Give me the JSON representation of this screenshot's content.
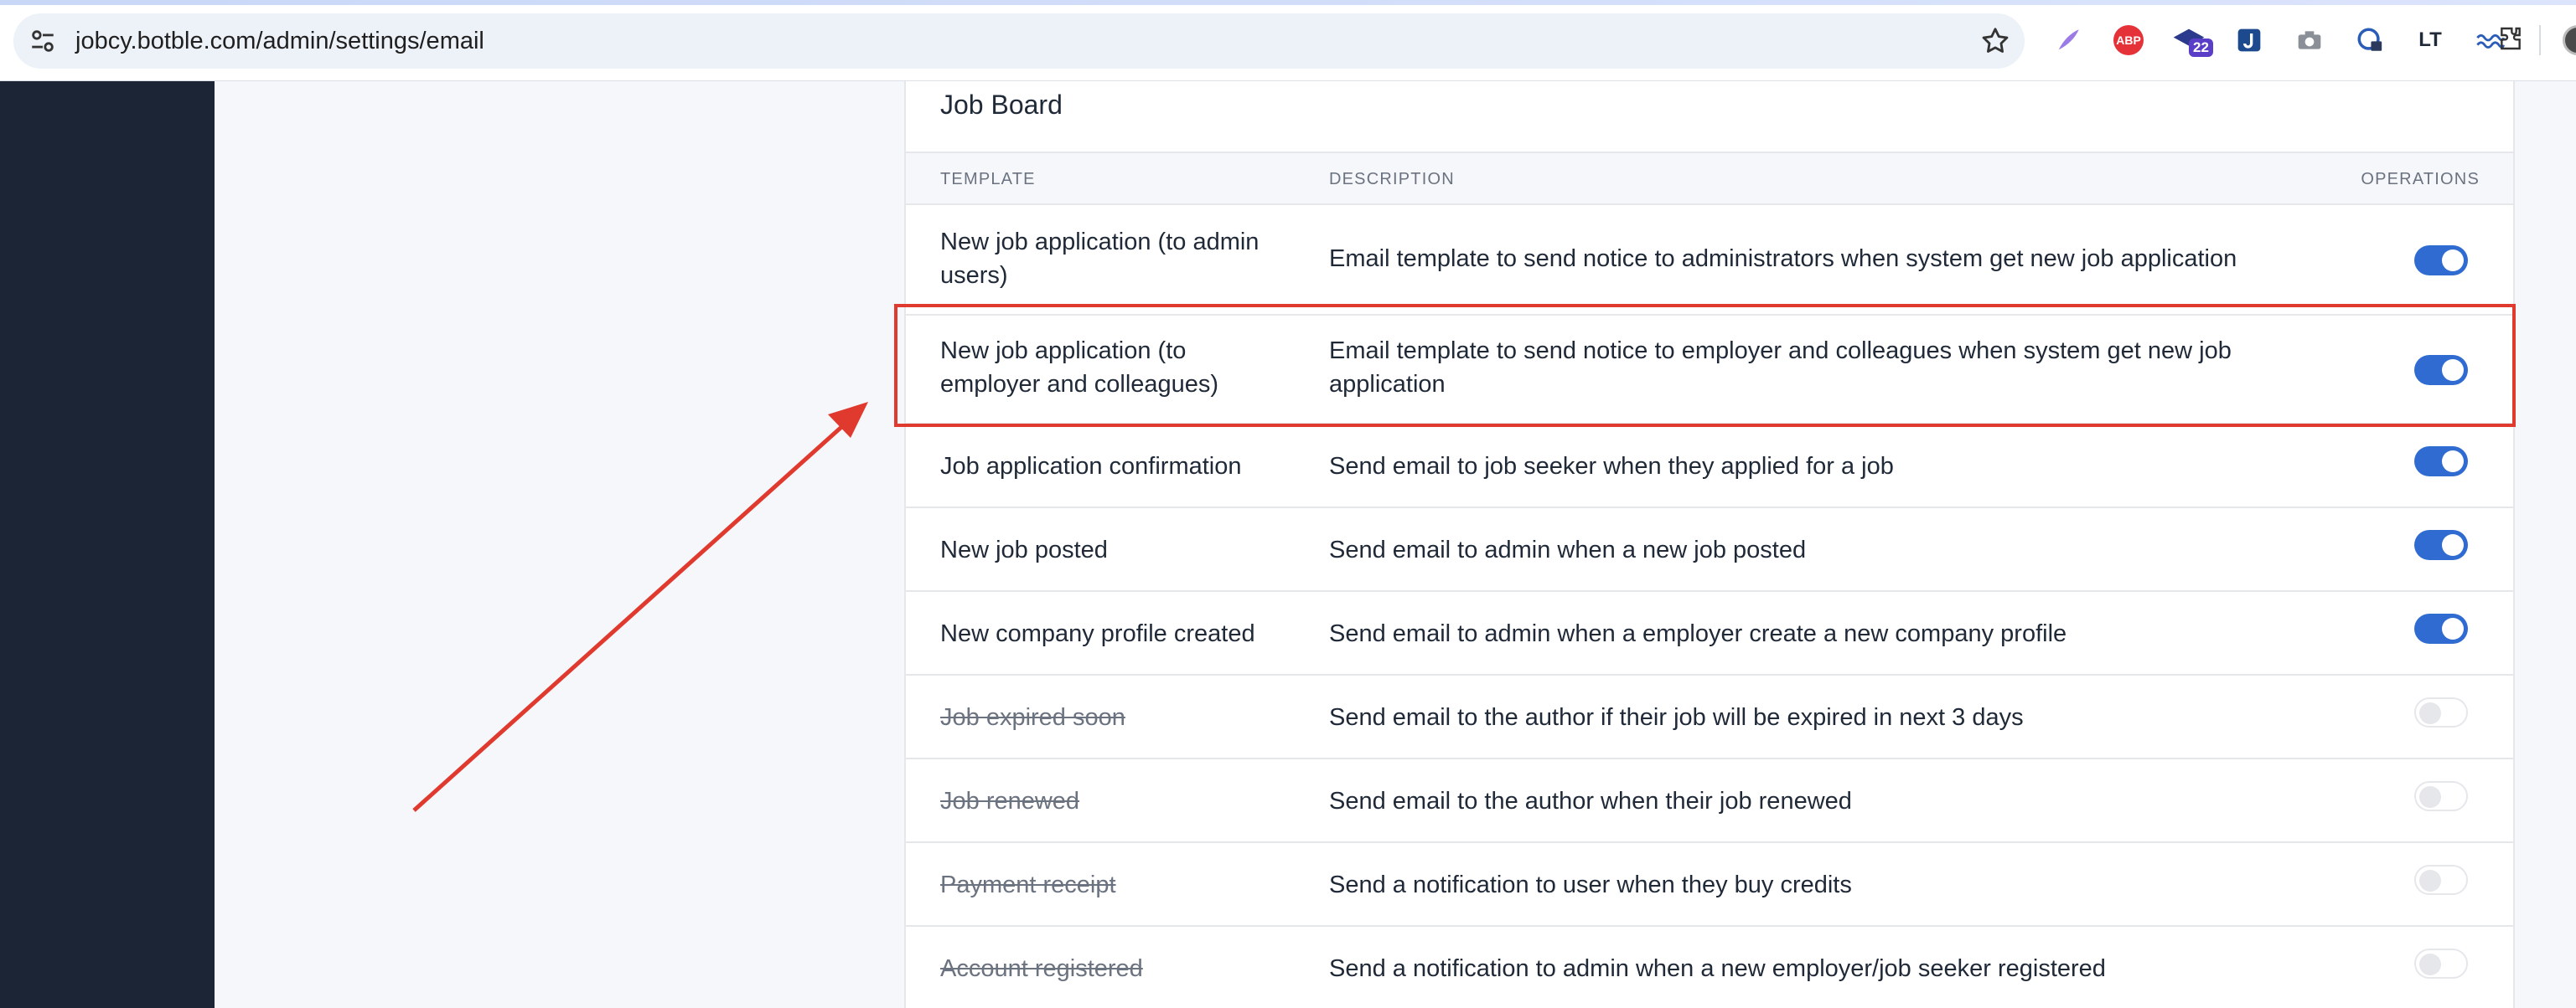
{
  "browser": {
    "url": "jobcy.botble.com/admin/settings/email",
    "extensions": [
      {
        "name": "quill-icon"
      },
      {
        "name": "adblock-icon",
        "label": "ABP"
      },
      {
        "name": "grad-cap-icon",
        "badge": "22"
      },
      {
        "name": "jira-icon"
      },
      {
        "name": "camera-icon"
      },
      {
        "name": "key-lock-icon"
      },
      {
        "name": "languagetool-icon",
        "label": "LT"
      },
      {
        "name": "wave-icon"
      },
      {
        "name": "puzzle-icon"
      }
    ]
  },
  "card": {
    "title": "Job Board",
    "headers": {
      "template": "TEMPLATE",
      "description": "DESCRIPTION",
      "operations": "OPERATIONS"
    },
    "rows": [
      {
        "name": "New job application (to admin users)",
        "description": "Email template to send notice to administrators when system get new job application",
        "enabled": true
      },
      {
        "name": "New job application (to employer and colleagues)",
        "description": "Email template to send notice to employer and colleagues when system get new job application",
        "enabled": true
      },
      {
        "name": "Job application confirmation",
        "description": "Send email to job seeker when they applied for a job",
        "enabled": true
      },
      {
        "name": "New job posted",
        "description": "Send email to admin when a new job posted",
        "enabled": true
      },
      {
        "name": "New company profile created",
        "description": "Send email to admin when a employer create a new company profile",
        "enabled": true
      },
      {
        "name": "Job expired soon",
        "description": "Send email to the author if their job will be expired in next 3 days",
        "enabled": false
      },
      {
        "name": "Job renewed",
        "description": "Send email to the author when their job renewed",
        "enabled": false
      },
      {
        "name": "Payment receipt",
        "description": "Send a notification to user when they buy credits",
        "enabled": false
      },
      {
        "name": "Account registered",
        "description": "Send a notification to admin when a new employer/job seeker registered",
        "enabled": false
      }
    ]
  },
  "annotation": {
    "color": "#e03a2f",
    "highlighted_row": 1
  },
  "colors": {
    "sidebar": "#1b2535",
    "toggle_on": "#2f6bd1"
  }
}
